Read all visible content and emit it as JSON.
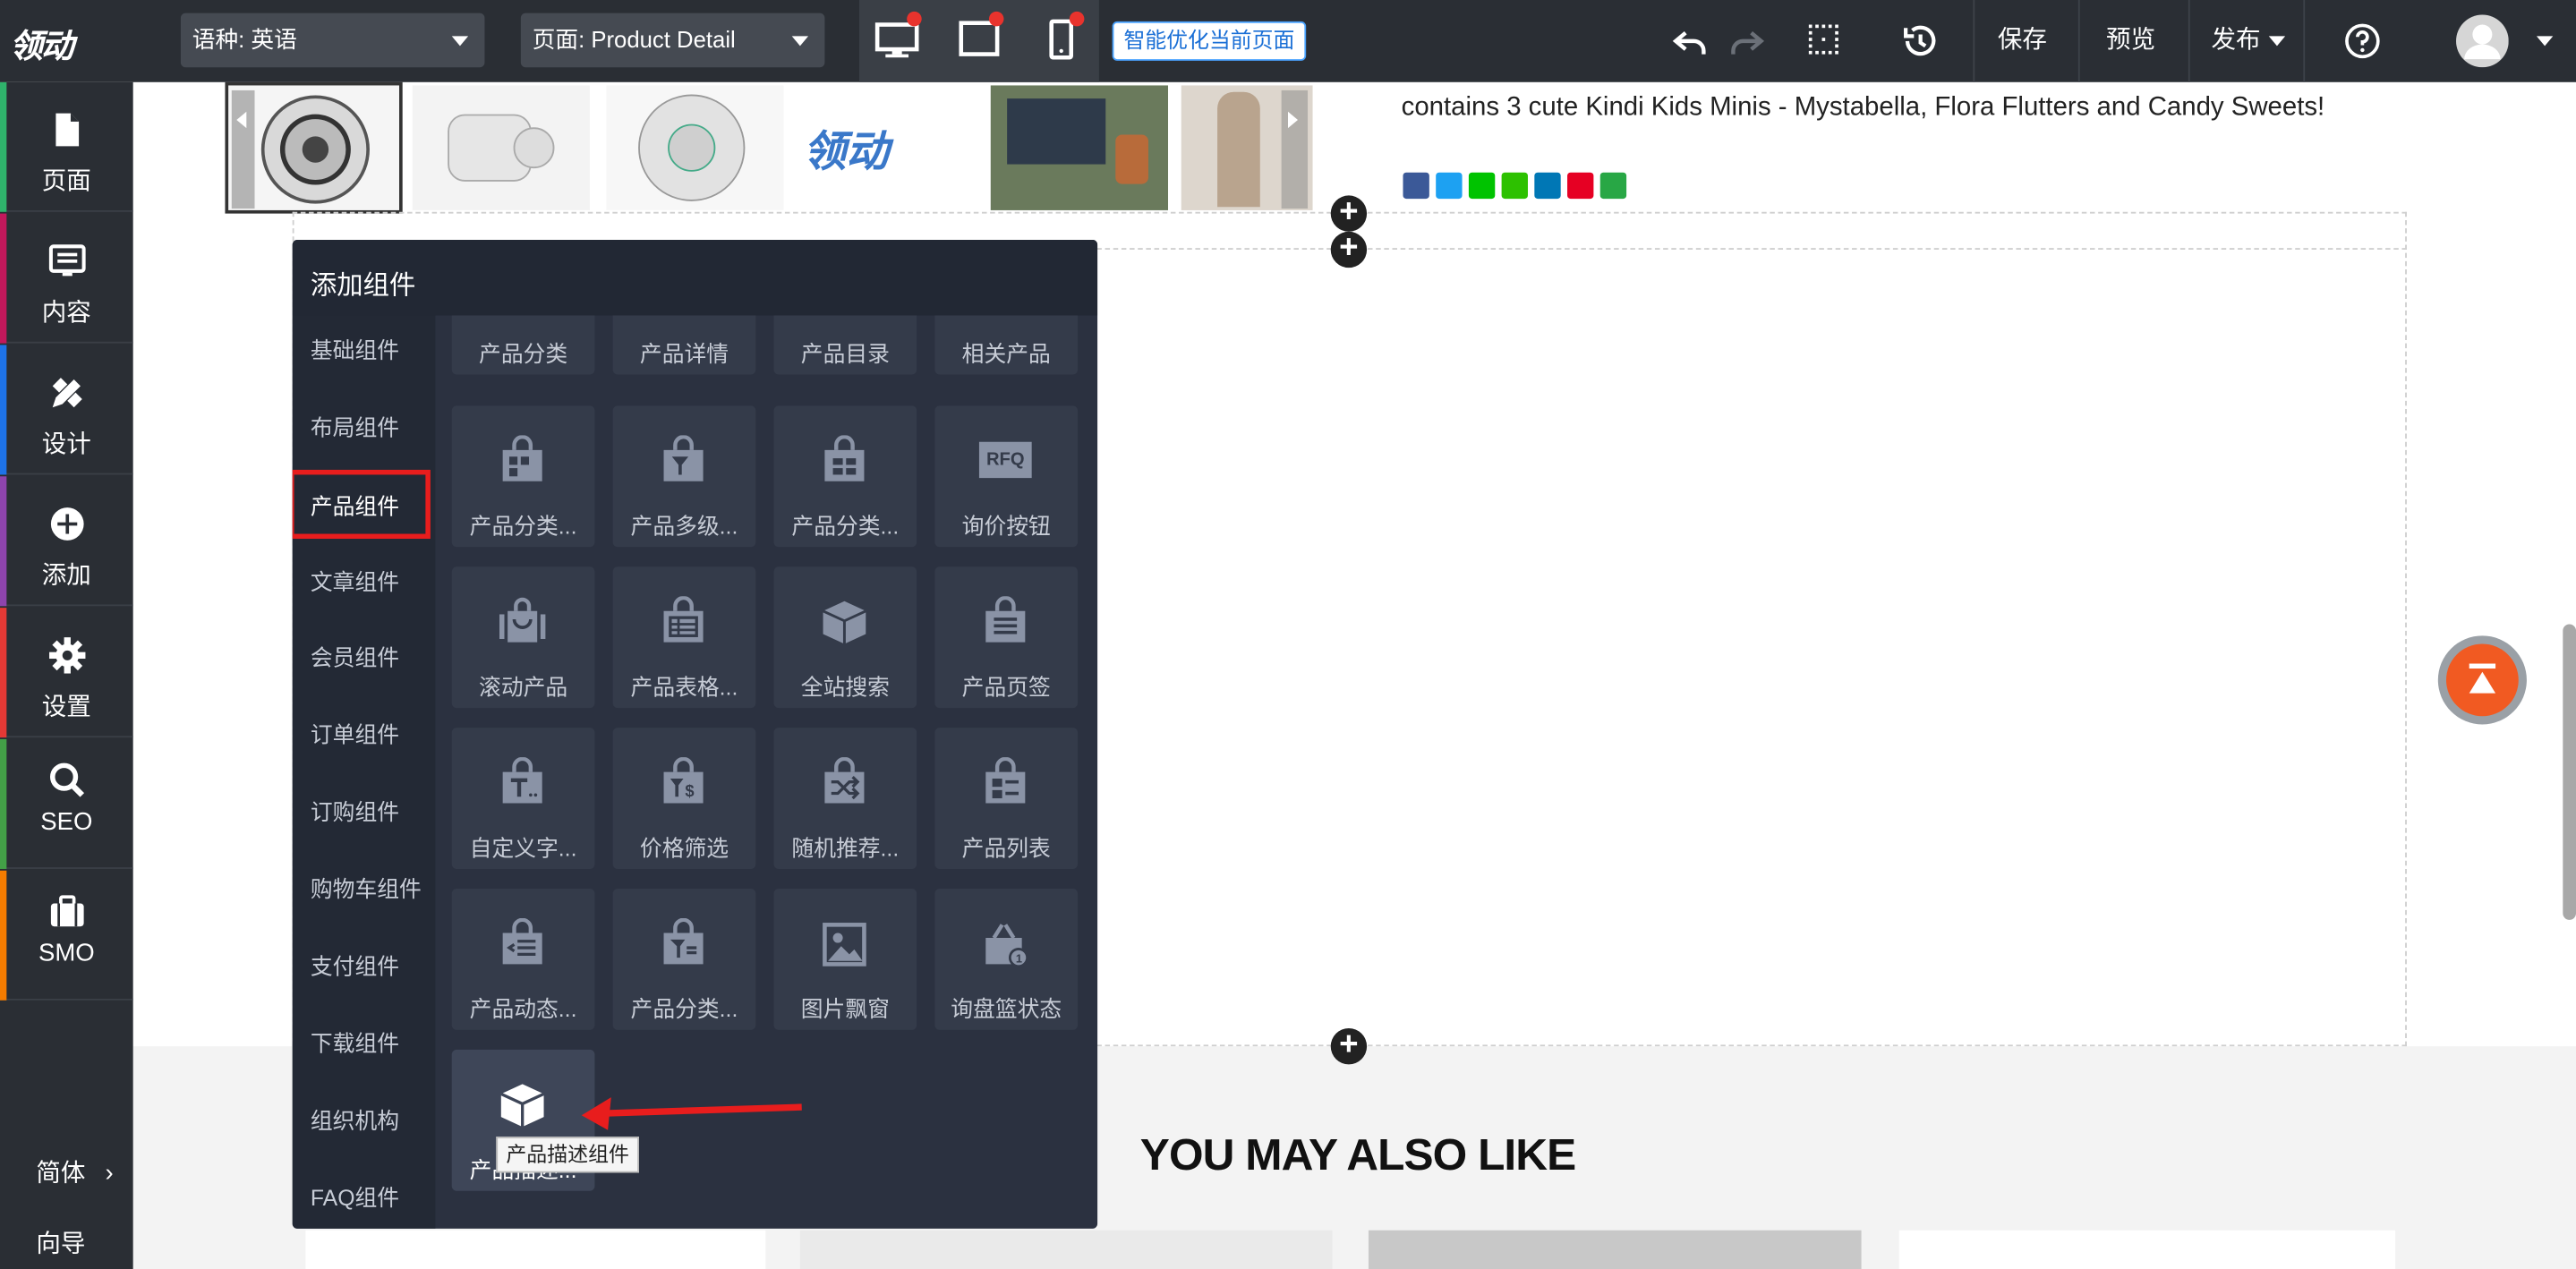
{
  "topbar": {
    "logo": "领动",
    "language_select": "语种: 英语",
    "page_select": "页面: Product Detail",
    "smart_optimize": "智能优化当前页面",
    "save": "保存",
    "preview": "预览",
    "publish": "发布"
  },
  "sidebar": {
    "items": [
      {
        "label": "页面",
        "color": "#2fb36b"
      },
      {
        "label": "内容",
        "color": "#c2185b"
      },
      {
        "label": "设计",
        "color": "#1e73e8"
      },
      {
        "label": "添加",
        "color": "#8e44ad"
      },
      {
        "label": "设置",
        "color": "#e53935"
      },
      {
        "label": "SEO",
        "color": "#43a047"
      },
      {
        "label": "SMO",
        "color": "#f57c00"
      }
    ],
    "lang": "简体",
    "guide": "向导"
  },
  "content": {
    "description": "contains 3 cute Kindi Kids Minis - Mystabella, Flora Flutters and Candy Sweets!",
    "you_may_also_like": "YOU MAY ALSO LIKE"
  },
  "panel": {
    "title": "添加组件",
    "categories": [
      "基础组件",
      "布局组件",
      "产品组件",
      "文章组件",
      "会员组件",
      "订单组件",
      "订购组件",
      "购物车组件",
      "支付组件",
      "下载组件",
      "组织机构",
      "FAQ组件"
    ],
    "active_category": "产品组件",
    "tiles": [
      "产品分类",
      "产品详情",
      "产品目录",
      "相关产品",
      "产品分类...",
      "产品多级...",
      "产品分类...",
      "询价按钮",
      "滚动产品",
      "产品表格...",
      "全站搜索",
      "产品页签",
      "自定义字...",
      "价格筛选",
      "随机推荐...",
      "产品列表",
      "产品动态...",
      "产品分类...",
      "图片飘窗",
      "询盘篮状态",
      "产品描述..."
    ],
    "tooltip": "产品描述组件",
    "rfq": "RFQ"
  }
}
